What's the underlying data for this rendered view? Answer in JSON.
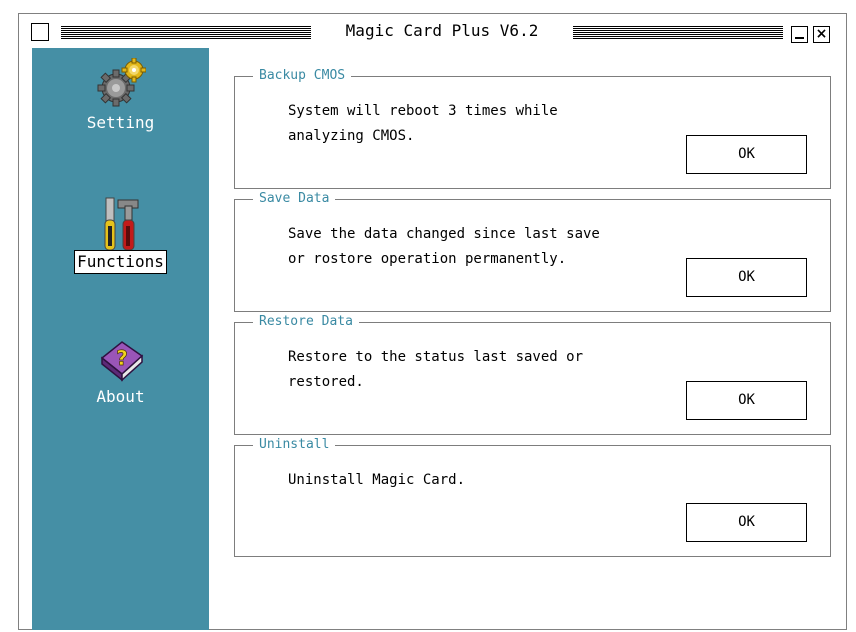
{
  "window": {
    "title": "Magic Card Plus V6.2",
    "minimize_symbol": "_",
    "close_symbol": "×"
  },
  "sidebar": {
    "items": [
      {
        "label": "Setting",
        "icon": "gears-icon",
        "active": false
      },
      {
        "label": "Functions",
        "icon": "tools-icon",
        "active": true
      },
      {
        "label": "About",
        "icon": "help-book-icon",
        "active": false
      }
    ]
  },
  "groups": [
    {
      "title": "Backup CMOS",
      "description": "System will reboot 3 times while\nanalyzing CMOS.",
      "button": "OK"
    },
    {
      "title": "Save Data",
      "description": "Save the data changed since last save\nor rostore operation permanently.",
      "button": "OK"
    },
    {
      "title": "Restore Data",
      "description": "Restore to the status last saved or\nrestored.",
      "button": "OK"
    },
    {
      "title": "Uninstall",
      "description": "Uninstall Magic Card.",
      "button": "OK"
    }
  ],
  "colors": {
    "sidebar": "#458fa5",
    "legend_text": "#3a8aa3",
    "border": "#7d7d7d"
  }
}
